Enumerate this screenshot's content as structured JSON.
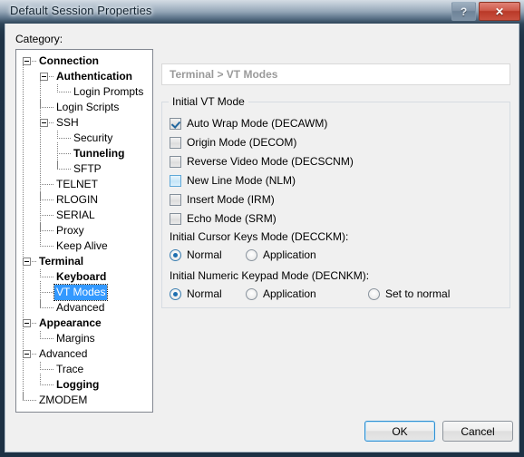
{
  "window": {
    "title": "Default Session Properties",
    "help_button": "?",
    "close_button": "✕"
  },
  "sidebar": {
    "label": "Category:",
    "selected": "VT Modes",
    "items": [
      {
        "label": "Connection",
        "depth": 0,
        "bold": true,
        "expander": true
      },
      {
        "label": "Authentication",
        "depth": 1,
        "bold": true,
        "expander": true
      },
      {
        "label": "Login Prompts",
        "depth": 2,
        "bold": false,
        "expander": false
      },
      {
        "label": "Login Scripts",
        "depth": 1,
        "bold": false,
        "expander": false
      },
      {
        "label": "SSH",
        "depth": 1,
        "bold": false,
        "expander": true
      },
      {
        "label": "Security",
        "depth": 2,
        "bold": false,
        "expander": false
      },
      {
        "label": "Tunneling",
        "depth": 2,
        "bold": true,
        "expander": false
      },
      {
        "label": "SFTP",
        "depth": 2,
        "bold": false,
        "expander": false
      },
      {
        "label": "TELNET",
        "depth": 1,
        "bold": false,
        "expander": false
      },
      {
        "label": "RLOGIN",
        "depth": 1,
        "bold": false,
        "expander": false
      },
      {
        "label": "SERIAL",
        "depth": 1,
        "bold": false,
        "expander": false
      },
      {
        "label": "Proxy",
        "depth": 1,
        "bold": false,
        "expander": false
      },
      {
        "label": "Keep Alive",
        "depth": 1,
        "bold": false,
        "expander": false
      },
      {
        "label": "Terminal",
        "depth": 0,
        "bold": true,
        "expander": true
      },
      {
        "label": "Keyboard",
        "depth": 1,
        "bold": true,
        "expander": false
      },
      {
        "label": "VT Modes",
        "depth": 1,
        "bold": false,
        "expander": false,
        "selected": true
      },
      {
        "label": "Advanced",
        "depth": 1,
        "bold": false,
        "expander": false
      },
      {
        "label": "Appearance",
        "depth": 0,
        "bold": true,
        "expander": true
      },
      {
        "label": "Margins",
        "depth": 1,
        "bold": false,
        "expander": false
      },
      {
        "label": "Advanced",
        "depth": 0,
        "bold": false,
        "expander": true
      },
      {
        "label": "Trace",
        "depth": 1,
        "bold": false,
        "expander": false
      },
      {
        "label": "Logging",
        "depth": 1,
        "bold": true,
        "expander": false
      },
      {
        "label": "ZMODEM",
        "depth": 0,
        "bold": false,
        "expander": false
      }
    ]
  },
  "main": {
    "breadcrumb": "Terminal > VT Modes",
    "group_title": "Initial VT Mode",
    "checkboxes": [
      {
        "label": "Auto Wrap Mode (DECAWM)",
        "checked": true,
        "hovered": false
      },
      {
        "label": "Origin Mode (DECOM)",
        "checked": false,
        "hovered": false
      },
      {
        "label": "Reverse Video Mode (DECSCNM)",
        "checked": false,
        "hovered": false
      },
      {
        "label": "New Line Mode (NLM)",
        "checked": false,
        "hovered": true
      },
      {
        "label": "Insert Mode (IRM)",
        "checked": false,
        "hovered": false
      },
      {
        "label": "Echo Mode (SRM)",
        "checked": false,
        "hovered": false
      }
    ],
    "cursor_keys": {
      "title": "Initial Cursor Keys Mode (DECCKM):",
      "options": [
        {
          "label": "Normal",
          "selected": true
        },
        {
          "label": "Application",
          "selected": false
        }
      ]
    },
    "numeric_keypad": {
      "title": "Initial Numeric Keypad Mode (DECNKM):",
      "options": [
        {
          "label": "Normal",
          "selected": true
        },
        {
          "label": "Application",
          "selected": false
        },
        {
          "label": "Set to normal",
          "selected": false
        }
      ]
    }
  },
  "footer": {
    "ok_label": "OK",
    "cancel_label": "Cancel"
  },
  "colors": {
    "selection_blue": "#3399ff",
    "breadcrumb_gray": "#9a9a9a",
    "frame_navy": "#1d3144",
    "close_red": "#b93928"
  }
}
